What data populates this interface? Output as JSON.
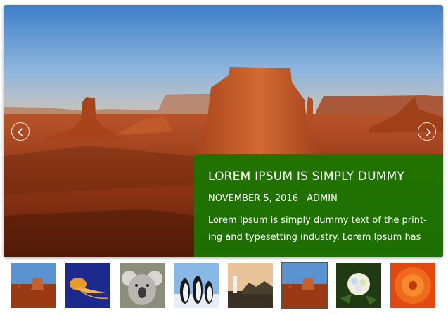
{
  "slide": {
    "title": "LOREM IPSUM IS SIMPLY DUMMY",
    "date": "NOVEMBER 5, 2016",
    "author": "ADMIN",
    "text": "Lorem Ipsum is simply dummy text of the print-ing and typesetting industry. Lorem Ipsum has",
    "image_icon": "monument-valley-image"
  },
  "navigation": {
    "prev_icon": "chevron-left-icon",
    "next_icon": "chevron-right-icon"
  },
  "thumbnails": [
    {
      "icon": "desert-thumbnail",
      "active": false
    },
    {
      "icon": "jellyfish-thumbnail",
      "active": false
    },
    {
      "icon": "koala-thumbnail",
      "active": false
    },
    {
      "icon": "penguins-thumbnail",
      "active": false
    },
    {
      "icon": "lighthouse-thumbnail",
      "active": false
    },
    {
      "icon": "desert-thumbnail",
      "active": true
    },
    {
      "icon": "hydrangea-thumbnail",
      "active": false
    },
    {
      "icon": "chrysanthemum-thumbnail",
      "active": false
    }
  ],
  "colors": {
    "caption_background": "#187600",
    "text": "#ffffff",
    "active_thumbnail_border": "#555555"
  }
}
